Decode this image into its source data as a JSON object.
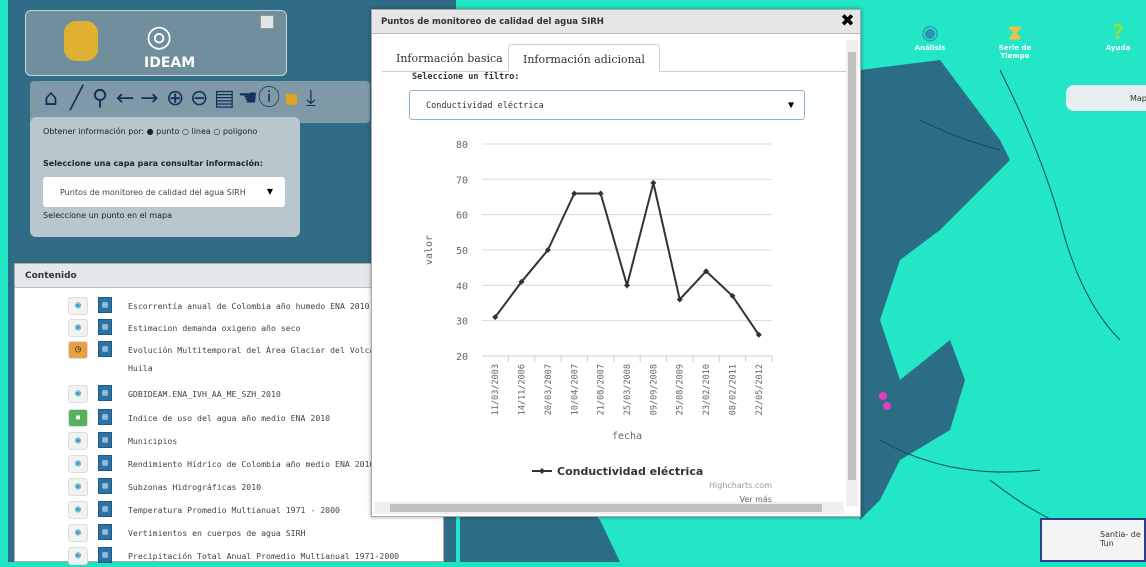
{
  "header": {
    "logo_text": "IDEAM"
  },
  "info_panel": {
    "get_info_label": "Obtener información por:",
    "options": [
      "punto",
      "linea",
      "poligono"
    ],
    "layer_label": "Seleccione una capa para consultar información:",
    "layer_value": "Puntos de monitoreo de calidad del agua SIRH",
    "hint": "Seleccione un punto en el mapa"
  },
  "contents": {
    "title": "Contenido",
    "items": [
      "Escorrentía anual de Colombia año humedo ENA 2010",
      "Estimacion demanda oxigeno año seco",
      "Evolución Multitemporal del Área Glaciar del Volcán",
      "Huila",
      "GDBIDEAM.ENA_IVH_AA_ME_SZH_2010",
      "Indice de uso del agua año medio ENA 2010",
      "Municipios",
      "Rendimiento Hídrico de Colombia año medio ENA 2010",
      "Subzonas Hidrográficas 2010",
      "Temperatura Promedio Multianual 1971 - 2000",
      "Vertimientos en cuerpos de agua SIRH",
      "Precipitación Total Anual Promedio Multianual 1971-2000"
    ]
  },
  "right_toolbar": {
    "analysis": "Análisis",
    "timeseries": "Serie de Tiempo",
    "help": "Ayuda",
    "map_button": "Map"
  },
  "map_label": "Santia- de Tun",
  "dialog": {
    "title": "Puntos de monitoreo de calidad del agua SIRH",
    "tabs": [
      "Información basica",
      "Información adicional"
    ],
    "filter_label": "Seleccione un filtro:",
    "filter_value": "Conductividad eléctrica",
    "credits": "Highcharts.com",
    "more": "Ver más"
  },
  "chart_data": {
    "type": "line",
    "title": "",
    "xlabel": "fecha",
    "ylabel": "valor",
    "ylim": [
      20,
      80
    ],
    "yticks": [
      20,
      30,
      40,
      50,
      60,
      70,
      80
    ],
    "categories": [
      "11/03/2003",
      "14/11/2006",
      "20/03/2007",
      "10/04/2007",
      "21/08/2007",
      "25/03/2008",
      "09/09/2008",
      "25/08/2009",
      "23/02/2010",
      "08/02/2011",
      "22/05/2012"
    ],
    "series": [
      {
        "name": "Conductividad eléctrica",
        "values": [
          31,
          41,
          50,
          66,
          66,
          40,
          69,
          36,
          44,
          37,
          26
        ]
      }
    ],
    "legend": "bottom-center",
    "colors": {
      "line": "#333333"
    }
  }
}
